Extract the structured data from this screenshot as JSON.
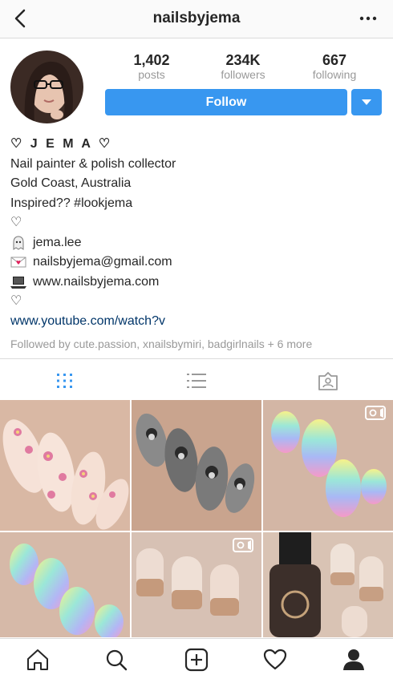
{
  "header": {
    "username": "nailsbyjema"
  },
  "stats": [
    {
      "value": "1,402",
      "label": "posts"
    },
    {
      "value": "234K",
      "label": "followers"
    },
    {
      "value": "667",
      "label": "following"
    }
  ],
  "actions": {
    "follow_label": "Follow"
  },
  "bio": {
    "name": "♡ J E M A ♡",
    "lines": [
      "Nail painter & polish collector",
      "Gold Coast, Australia",
      "Inspired?? #lookjema",
      "♡"
    ],
    "snapchat": "jema.lee",
    "email": "nailsbyjema@gmail.com",
    "website": "www.nailsbyjema.com",
    "heart2": "♡",
    "link": "www.youtube.com/watch?v",
    "followed_by": "Followed by cute.passion, xnailsbymiri, badgirlnails + 6 more"
  },
  "tabs": [
    {
      "icon": "grid-icon",
      "active": true
    },
    {
      "icon": "list-icon",
      "active": false
    },
    {
      "icon": "tagged-icon",
      "active": false
    }
  ],
  "posts": [
    {
      "icon": "photo",
      "subject": "floral nail art"
    },
    {
      "icon": "photo",
      "subject": "portrait nail art"
    },
    {
      "icon": "video-icon",
      "subject": "rainbow gradient nails"
    },
    {
      "icon": "photo",
      "subject": "pastel gradient nails"
    },
    {
      "icon": "video-icon",
      "subject": "glitter nude nails"
    },
    {
      "icon": "photo",
      "subject": "polish bottle with glitter nails"
    }
  ],
  "nav": [
    "home-icon",
    "search-icon",
    "add-post-icon",
    "activity-heart-icon",
    "profile-icon"
  ],
  "colors": {
    "accent": "#3897f0",
    "link": "#003569",
    "muted": "#999999",
    "text": "#262626"
  }
}
